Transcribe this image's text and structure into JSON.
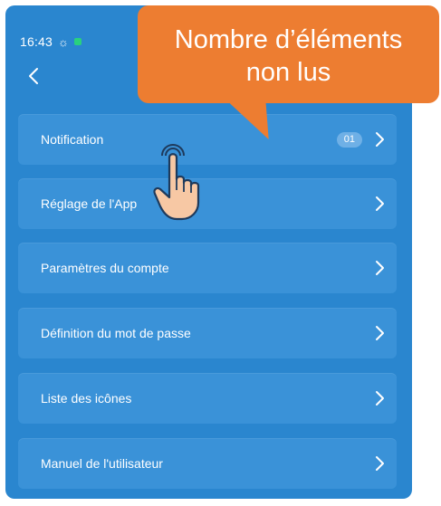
{
  "status_bar": {
    "time": "16:43"
  },
  "header": {
    "back_icon": "chevron-left-icon"
  },
  "menu": {
    "items": [
      {
        "label": "Notification",
        "badge": "01"
      },
      {
        "label": "Réglage de l'App"
      },
      {
        "label": "Paramètres du compte"
      },
      {
        "label": "Définition du mot de passe"
      },
      {
        "label": "Liste des icônes"
      },
      {
        "label": "Manuel de l'utilisateur"
      }
    ]
  },
  "callout": {
    "line1": "Nombre d’éléments",
    "line2": "non lus"
  },
  "colors": {
    "background": "#2a86cf",
    "item": "#3a92d8",
    "callout": "#ed7d31"
  },
  "icons": {
    "row_arrow": "chevron-right-icon",
    "pointer": "hand-pointer-icon"
  }
}
